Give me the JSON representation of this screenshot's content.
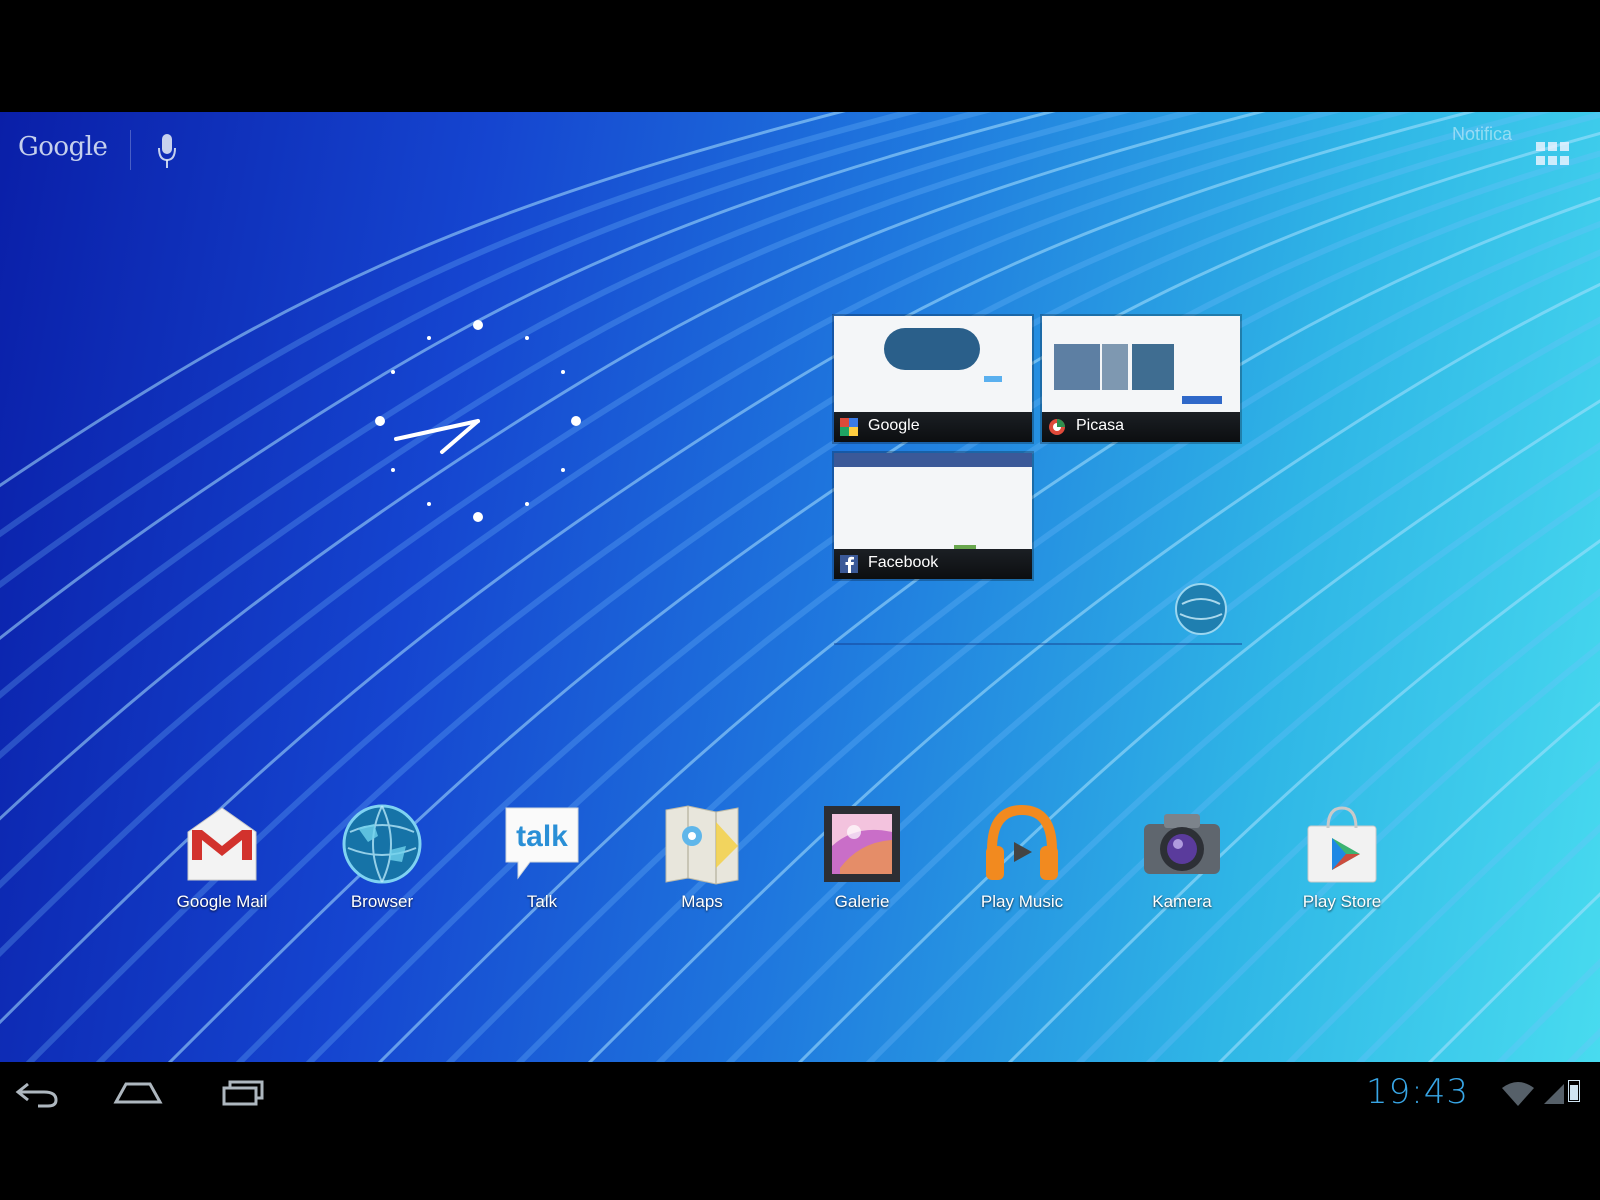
{
  "search_bar": {
    "google_label": "Google",
    "mic_icon": "microphone-icon"
  },
  "top_right": {
    "notification_text": "Notifica",
    "apps_icon": "all-apps-grid-icon"
  },
  "recents": [
    {
      "label": "Google",
      "icon": "google-plus-icon"
    },
    {
      "label": "Picasa",
      "icon": "picasa-icon"
    },
    {
      "label": "Facebook",
      "icon": "facebook-icon"
    }
  ],
  "dock": {
    "apps": [
      {
        "label": "Google Mail",
        "icon": "gmail-icon"
      },
      {
        "label": "Browser",
        "icon": "globe-icon"
      },
      {
        "label": "Talk",
        "icon": "talk-icon",
        "icon_text": "talk"
      },
      {
        "label": "Maps",
        "icon": "maps-icon"
      },
      {
        "label": "Galerie",
        "icon": "gallery-icon"
      },
      {
        "label": "Play Music",
        "icon": "headphones-icon"
      },
      {
        "label": "Kamera",
        "icon": "camera-icon"
      },
      {
        "label": "Play Store",
        "icon": "shopping-bag-icon"
      }
    ]
  },
  "nav_bar": {
    "buttons": [
      "back-icon",
      "home-icon",
      "recent-apps-icon"
    ],
    "time": "19:43",
    "status_icons": [
      "wifi-icon",
      "signal-icon",
      "battery-icon"
    ]
  },
  "colors": {
    "clock_accent": "#38a6e6",
    "wallpaper_dark": "#0a1fa8",
    "wallpaper_light": "#48dbef"
  }
}
